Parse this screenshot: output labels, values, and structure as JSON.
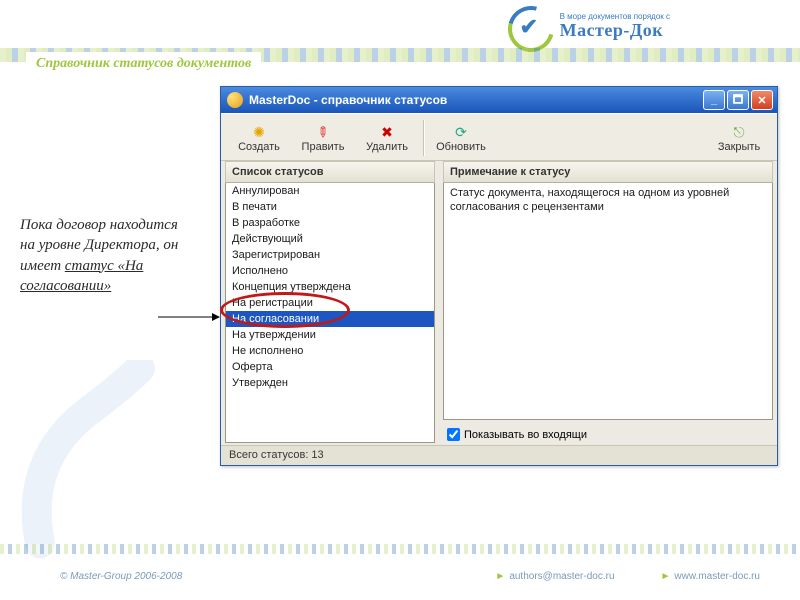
{
  "brand": {
    "tagline": "В море документов порядок с",
    "name": "Мастер-Док"
  },
  "page_title": "Справочник статусов документов",
  "annotation": {
    "line1": "Пока  договор находится на уровне Директора, он имеет ",
    "u1": "статус «На согласовании»"
  },
  "window": {
    "title": "MasterDoc - справочник статусов",
    "toolbar": {
      "create": "Создать",
      "edit": "Править",
      "delete": "Удалить",
      "refresh": "Обновить",
      "close": "Закрыть"
    },
    "left_header": "Список статусов",
    "right_header": "Примечание к статусу",
    "statuses": [
      "Аннулирован",
      "В печати",
      "В разработке",
      "Действующий",
      "Зарегистрирован",
      "Исполнено",
      "Концепция утверждена",
      "На регистрации",
      "На согласовании",
      "На утверждении",
      "Не исполнено",
      "Оферта",
      "Утвержден"
    ],
    "selected_index": 8,
    "remark_text": "Статус документа, находящегося на одном из уровней согласования с рецензентами",
    "show_in_inbox": "Показывать во входящи",
    "statusbar": "Всего статусов: 13"
  },
  "footer": {
    "copyright": "© Master-Group 2006-2008",
    "email": "authors@master-doc.ru",
    "site": "www.master-doc.ru"
  }
}
